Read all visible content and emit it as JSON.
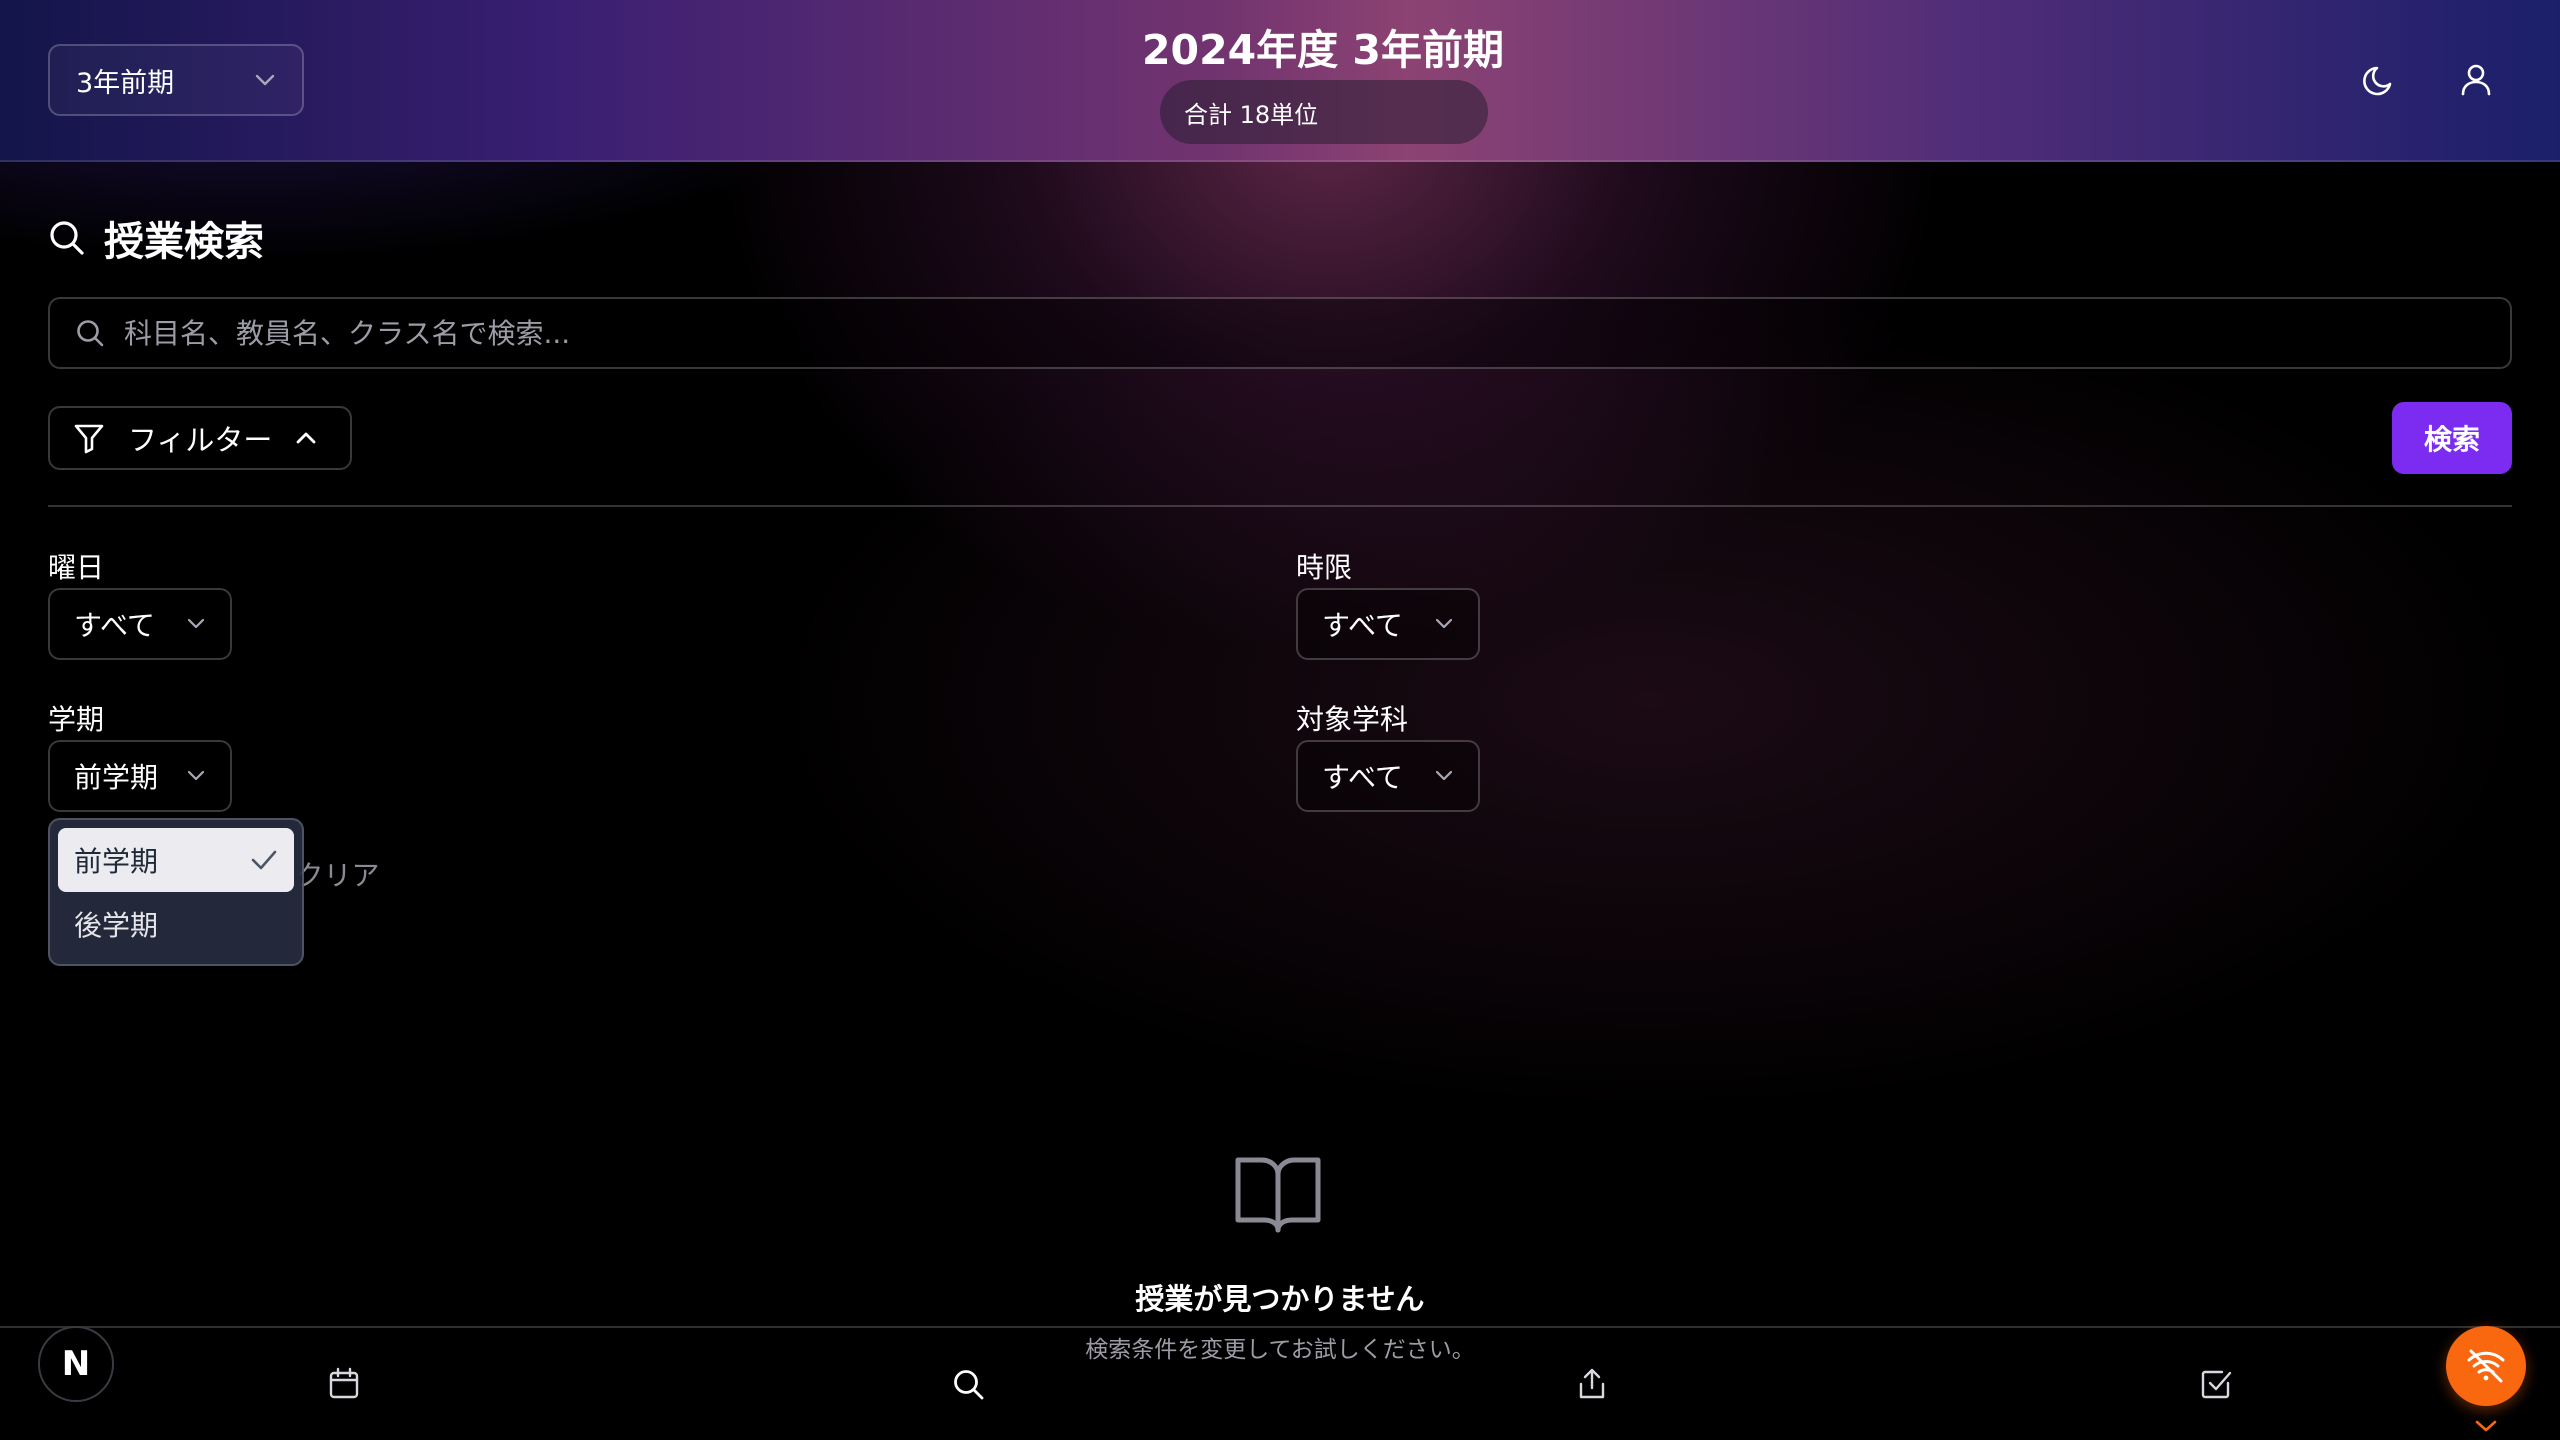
{
  "header": {
    "term_select": "3年前期",
    "title": "2024年度 3年前期",
    "credits": "合計 18単位",
    "icons": [
      "moon-icon",
      "user-icon"
    ]
  },
  "search": {
    "section_title": "授業検索",
    "placeholder": "科目名、教員名、クラス名で検索...",
    "filter_label": "フィルター",
    "submit_label": "検索"
  },
  "filters": {
    "day": {
      "label": "曜日",
      "value": "すべて"
    },
    "period": {
      "label": "時限",
      "value": "すべて"
    },
    "semester": {
      "label": "学期",
      "value": "前学期",
      "options": [
        "前学期",
        "後学期"
      ]
    },
    "department": {
      "label": "対象学科",
      "value": "すべて"
    },
    "clear_label": "フィルターをクリア"
  },
  "empty_state": {
    "title": "授業が見つかりません",
    "subtitle": "検索条件を変更してお試しください。"
  },
  "bottom_nav": {
    "logo": "N",
    "items": [
      "calendar-icon",
      "search-icon",
      "share-icon",
      "checkbox-icon"
    ]
  },
  "colors": {
    "accent": "#7c2cf0",
    "offline": "#f9670f",
    "background": "#000000"
  }
}
